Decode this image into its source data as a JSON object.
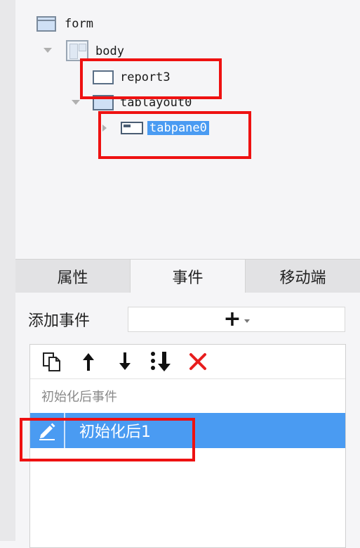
{
  "tree": {
    "form": "form",
    "body": "body",
    "report3": "report3",
    "tablayout0": "tablayout0",
    "tabpane0": "tabpane0"
  },
  "tabs": [
    "属性",
    "事件",
    "移动端"
  ],
  "active_tab": "事件",
  "add_event": {
    "label": "添加事件",
    "button": "+"
  },
  "toolbar_icons": [
    "copy-icon",
    "arrow-up-icon",
    "arrow-down-icon",
    "move-to-bottom-icon",
    "delete-icon"
  ],
  "event_group": "初始化后事件",
  "events": [
    {
      "label": "初始化后1",
      "selected": true
    }
  ],
  "colors": {
    "selection": "#4a9bf2",
    "highlight_box": "#ee1111",
    "delete": "#e81e1e"
  }
}
